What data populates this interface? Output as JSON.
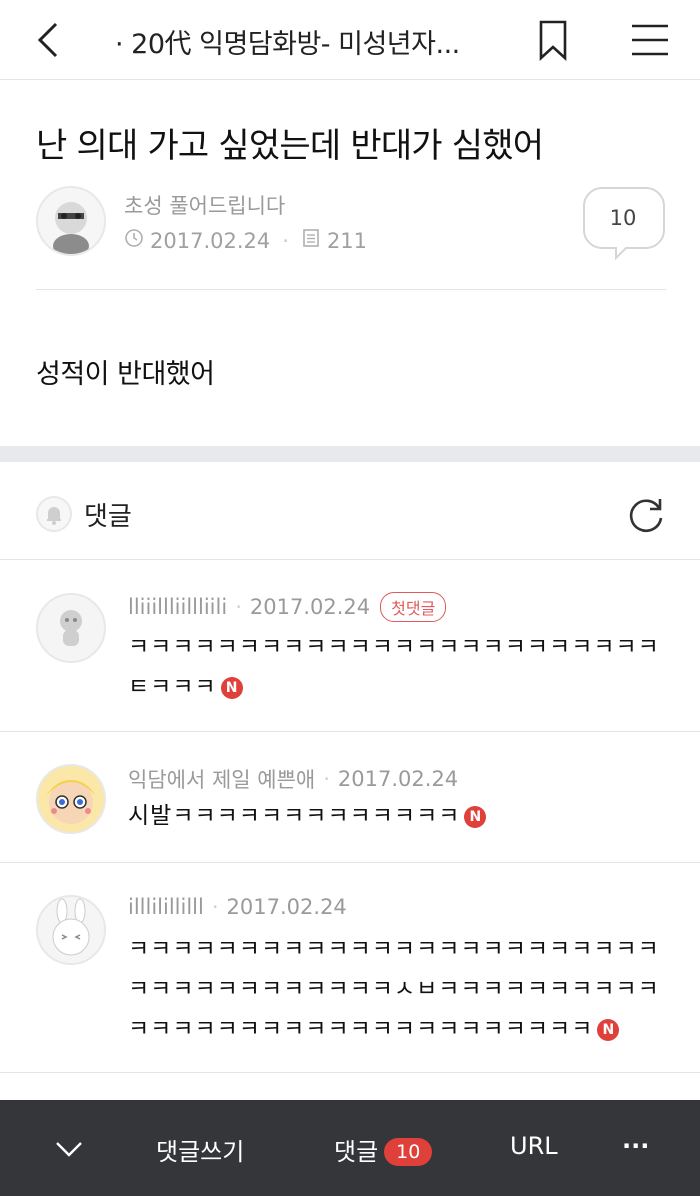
{
  "header": {
    "title": "· 20代 익명담화방- 미성년자..."
  },
  "post": {
    "title": "난 의대 가고 싶었는데 반대가 심했어",
    "author": "초성 풀어드립니다",
    "date": "2017.02.24",
    "views": "211",
    "comment_count": "10",
    "body": "성적이 반대했어"
  },
  "comments_section": {
    "label": "댓글"
  },
  "comments": [
    {
      "author": "lliiillliillliili",
      "date": "2017.02.24",
      "badge": "첫댓글",
      "text": "ㅋㅋㅋㅋㅋㅋㅋㅋㅋㅋㅋㅋㅋㅋㅋㅋㅋㅋㅋㅋㅋㅋㅋㅋㅌㅋㅋㅋ",
      "new_mark": "N"
    },
    {
      "author": "익담에서 제일 예쁜애",
      "date": "2017.02.24",
      "text": "시발ㅋㅋㅋㅋㅋㅋㅋㅋㅋㅋㅋㅋㅋ",
      "new_mark": "N"
    },
    {
      "author": "illlilillilll",
      "date": "2017.02.24",
      "text": "ㅋㅋㅋㅋㅋㅋㅋㅋㅋㅋㅋㅋㅋㅋㅋㅋㅋㅋㅋㅋㅋㅋㅋㅋㅋㅋㅋㅋㅋㅋㅋㅋㅋㅋㅋㅋㅅㅂㅋㅋㅋㅋㅋㅋㅋㅋㅋㅋㅋㅋㅋㅋㅋㅋㅋㅋㅋㅋㅋㅋㅋㅋㅋㅋㅋㅋㅋㅋㅋ",
      "new_mark": "N"
    }
  ],
  "bottom_bar": {
    "write_comment": "댓글쓰기",
    "comments_label": "댓글",
    "comments_count": "10",
    "url": "URL",
    "more": "···"
  },
  "colors": {
    "accent_red": "#e0403a",
    "bottom_bar_bg": "#35363a",
    "meta_gray": "#9a9a9a"
  }
}
